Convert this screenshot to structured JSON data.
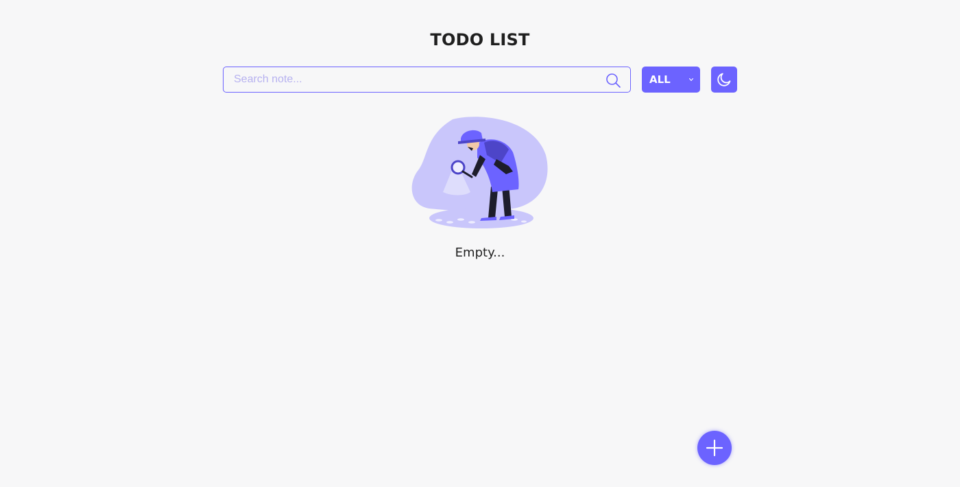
{
  "header": {
    "title": "TODO LIST"
  },
  "search": {
    "placeholder": "Search note...",
    "value": "",
    "icon": "search-icon"
  },
  "filter": {
    "selected": "ALL",
    "icon": "chevron-down-icon"
  },
  "theme_toggle": {
    "icon": "moon-icon"
  },
  "empty_state": {
    "illustration": "detective-magnifier-illustration",
    "text": "Empty..."
  },
  "fab": {
    "icon": "plus-icon"
  },
  "colors": {
    "accent": "#6c63ff",
    "background": "#f7f7f8",
    "text": "#1f1f1f",
    "placeholder": "#b7b2f0"
  }
}
